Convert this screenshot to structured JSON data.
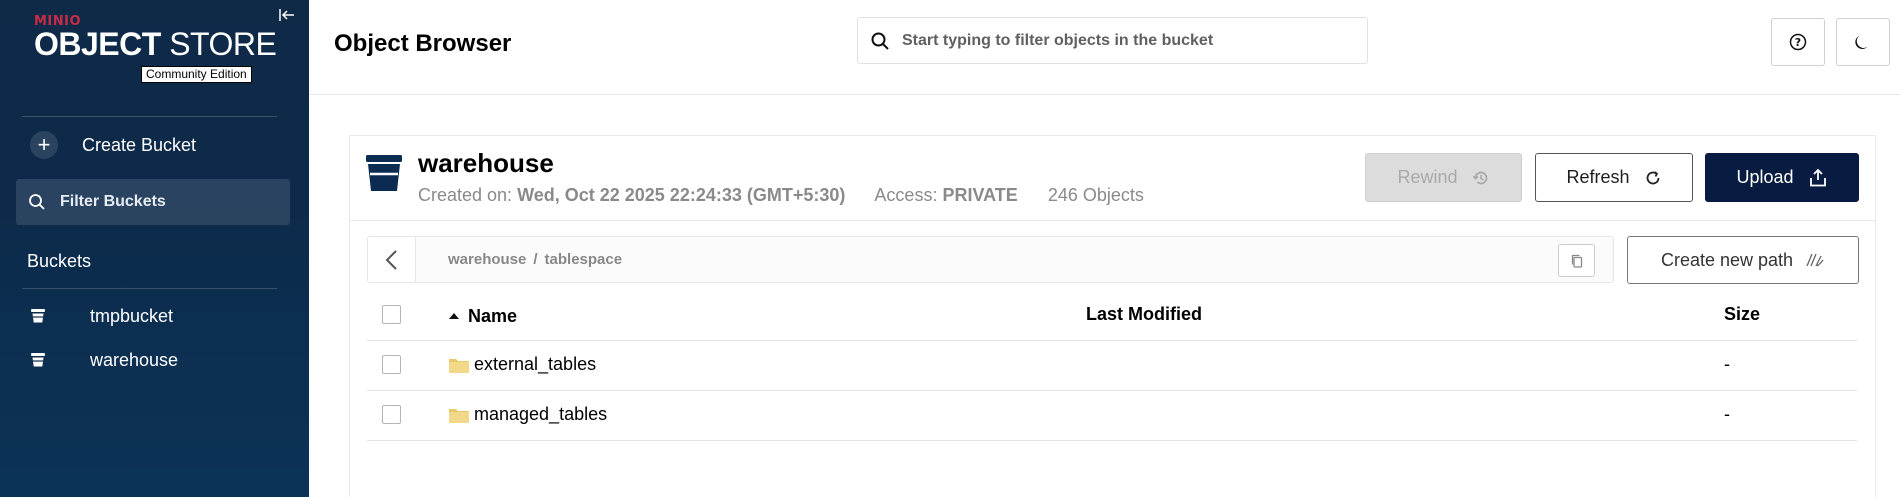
{
  "sidebar": {
    "brand": "MINIO",
    "product_bold": "OBJECT",
    "product_light": " STORE",
    "edition": "Community Edition",
    "create_bucket_label": "Create Bucket",
    "filter_buckets_label": "Filter Buckets",
    "buckets_heading": "Buckets",
    "buckets": [
      {
        "name": "tmpbucket"
      },
      {
        "name": "warehouse"
      }
    ]
  },
  "header": {
    "title": "Object Browser",
    "search_placeholder": "Start typing to filter objects in the bucket"
  },
  "bucket": {
    "name": "warehouse",
    "created_label": "Created on: ",
    "created_value": "Wed, Oct 22 2025 22:24:33 (GMT+5:30)",
    "access_label": "Access: ",
    "access_value": "PRIVATE",
    "object_count": "246 Objects"
  },
  "actions": {
    "rewind_label": "Rewind",
    "refresh_label": "Refresh",
    "upload_label": "Upload",
    "create_path_label": "Create new path"
  },
  "breadcrumb": {
    "parts": [
      "warehouse",
      "tablespace"
    ],
    "separator": "/"
  },
  "table": {
    "columns": {
      "name": "Name",
      "modified": "Last Modified",
      "size": "Size"
    },
    "rows": [
      {
        "name": "external_tables",
        "modified": "",
        "size": "-"
      },
      {
        "name": "managed_tables",
        "modified": "",
        "size": "-"
      }
    ]
  },
  "colors": {
    "sidebar_bg": "#0d2a4a",
    "brand_red": "#c72c48",
    "upload_bg": "#081c42",
    "folder": "#e8c96a"
  }
}
